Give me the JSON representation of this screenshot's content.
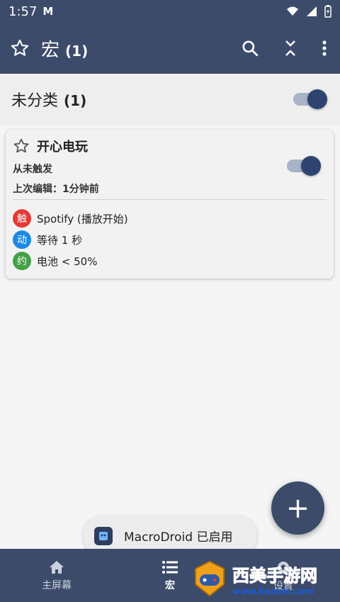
{
  "status": {
    "time": "1:57",
    "brand": "M"
  },
  "appbar": {
    "title": "宏",
    "count": "(1)"
  },
  "category": {
    "label": "未分类",
    "count": "(1)",
    "enabled": true
  },
  "macro": {
    "name": "开心电玩",
    "trigger_status": "从未触发",
    "last_edit": "上次编辑：1分钟前",
    "enabled": true,
    "rows": [
      {
        "badge": "触",
        "text": "Spotify (播放开始)",
        "color": "#e53935"
      },
      {
        "badge": "动",
        "text": "等待 1 秒",
        "color": "#1e88e5"
      },
      {
        "badge": "约",
        "text": "电池 < 50%",
        "color": "#43a047"
      }
    ]
  },
  "fab": {
    "icon": "+"
  },
  "toast": {
    "message": "MacroDroid 已启用"
  },
  "bottom_nav": {
    "items": [
      {
        "label": "主屏幕"
      },
      {
        "label": "宏"
      },
      {
        "label": "设置"
      }
    ]
  },
  "watermark": {
    "main": "西美手游网",
    "url": "www.hanxm.com"
  },
  "colors": {
    "primary": "#3d4b6b",
    "toggle_knob": "#2f4370"
  }
}
